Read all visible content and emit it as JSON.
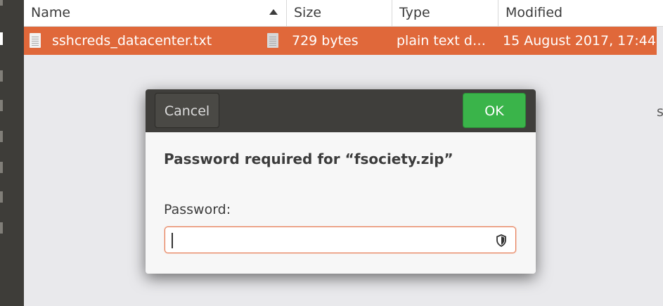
{
  "columns": {
    "name": "Name",
    "size": "Size",
    "type": "Type",
    "modified": "Modified"
  },
  "file": {
    "name": "sshcreds_datacenter.txt",
    "size": "729 bytes",
    "type": "plain text d…",
    "modified": "15 August 2017, 17:44"
  },
  "edge_text": "s",
  "dialog": {
    "cancel_label": "Cancel",
    "ok_label": "OK",
    "title": "Password required for “fsociety.zip”",
    "password_label": "Password:",
    "password_value": ""
  },
  "colors": {
    "selection": "#e0683a",
    "ok_button": "#3ab44a",
    "header_bar": "#3f3e3b"
  }
}
